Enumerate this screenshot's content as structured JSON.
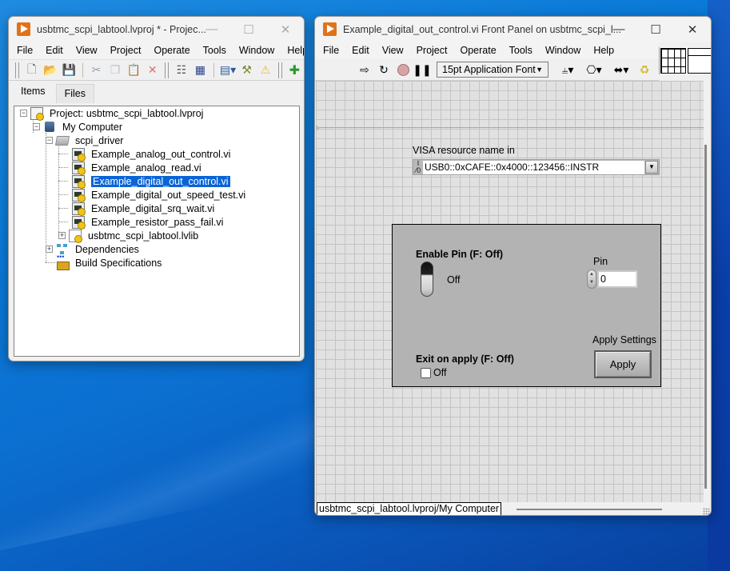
{
  "project_window": {
    "title": "usbtmc_scpi_labtool.lvproj * - Projec...",
    "window_buttons": {
      "minimize": "—",
      "maximize": "☐",
      "close": "✕"
    },
    "menu": [
      "File",
      "Edit",
      "View",
      "Project",
      "Operate",
      "Tools",
      "Window",
      "Help"
    ],
    "toolbar_icons": [
      "new-icon",
      "open-icon",
      "save-all-icon",
      "cut-icon",
      "copy-icon",
      "paste-icon",
      "delete-icon",
      "add-file-icon",
      "save-project-icon",
      "view-options-icon",
      "properties-icon",
      "warning-icon",
      "add-item-icon"
    ],
    "tabs": [
      {
        "label": "Items",
        "active": true
      },
      {
        "label": "Files",
        "active": false
      }
    ],
    "tree": [
      {
        "label": "Project: usbtmc_scpi_labtool.lvproj",
        "icon": "project-icon",
        "level": 0,
        "expander": "minus"
      },
      {
        "label": "My Computer",
        "icon": "computer-icon",
        "level": 1,
        "expander": "minus"
      },
      {
        "label": "scpi_driver",
        "icon": "folder-icon",
        "level": 2,
        "expander": "minus"
      },
      {
        "label": "Example_analog_out_control.vi",
        "icon": "vi-icon",
        "level": 3
      },
      {
        "label": "Example_analog_read.vi",
        "icon": "vi-icon",
        "level": 3
      },
      {
        "label": "Example_digital_out_control.vi",
        "icon": "vi-icon",
        "level": 3,
        "selected": true
      },
      {
        "label": "Example_digital_out_speed_test.vi",
        "icon": "vi-icon",
        "level": 3
      },
      {
        "label": "Example_digital_srq_wait.vi",
        "icon": "vi-icon",
        "level": 3
      },
      {
        "label": "Example_resistor_pass_fail.vi",
        "icon": "vi-icon",
        "level": 3
      },
      {
        "label": "usbtmc_scpi_labtool.lvlib",
        "icon": "library-icon",
        "level": 3,
        "expander": "plus"
      },
      {
        "label": "Dependencies",
        "icon": "dependencies-icon",
        "level": 2,
        "expander": "plus"
      },
      {
        "label": "Build Specifications",
        "icon": "build-specs-icon",
        "level": 2
      }
    ]
  },
  "front_panel": {
    "title": "Example_digital_out_control.vi Front Panel on usbtmc_scpi_l...",
    "window_buttons": {
      "minimize": "—",
      "maximize": "☐",
      "close": "✕"
    },
    "menu": [
      "File",
      "Edit",
      "View",
      "Project",
      "Operate",
      "Tools",
      "Window",
      "Help"
    ],
    "toolbar": {
      "icons": [
        "run-arrow-icon",
        "run-continuously-icon",
        "abort-icon",
        "pause-icon"
      ],
      "font_select": "15pt Application Font",
      "layout_icons": [
        "align-objects-icon",
        "distribute-objects-icon",
        "resize-objects-icon",
        "reorder-icon"
      ]
    },
    "controls": {
      "visa_label": "VISA resource name in",
      "visa_icon": "I/0",
      "visa_value": "USB0::0xCAFE::0x4000::123456::INSTR",
      "enable_pin_label": "Enable Pin (F: Off)",
      "enable_pin_state": "Off",
      "pin_label": "Pin",
      "pin_value": "0",
      "apply_settings_label": "Apply Settings",
      "apply_button": "Apply",
      "exit_on_apply_label": "Exit on apply (F: Off)",
      "exit_on_apply_state": "Off"
    },
    "status_context": "usbtmc_scpi_labtool.lvproj/My Computer"
  }
}
